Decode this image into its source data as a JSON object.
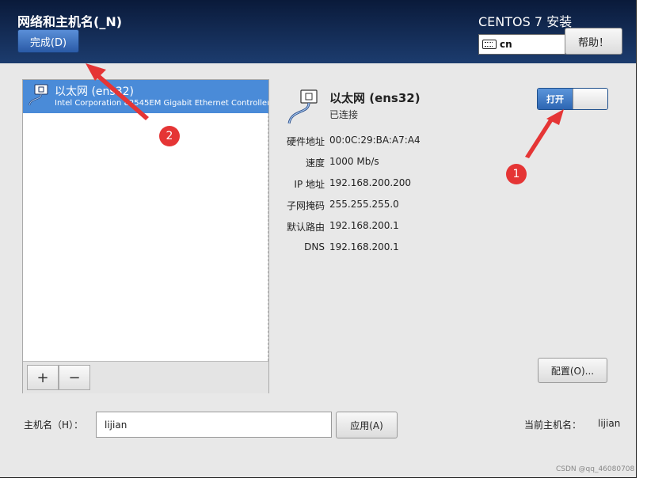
{
  "header": {
    "title": "网络和主机名(_N)",
    "done_label": "完成(D)",
    "product": "CENTOS 7 安装",
    "keyboard_layout": "cn",
    "help_label": "帮助！"
  },
  "devices": [
    {
      "name": "以太网 (ens32)",
      "description": "Intel Corporation 82545EM Gigabit Ethernet Controller (",
      "selected": true
    }
  ],
  "list_toolbar": {
    "add_label": "+",
    "remove_label": "−"
  },
  "detail": {
    "title": "以太网 (ens32)",
    "status": "已连接",
    "toggle_label": "打开",
    "toggle_on": true,
    "properties": [
      {
        "label": "硬件地址",
        "value": "00:0C:29:BA:A7:A4"
      },
      {
        "label": "速度",
        "value": "1000 Mb/s"
      },
      {
        "label": "IP 地址",
        "value": "192.168.200.200"
      },
      {
        "label": "子网掩码",
        "value": "255.255.255.0"
      },
      {
        "label": "默认路由",
        "value": "192.168.200.1"
      },
      {
        "label": "DNS",
        "value": "192.168.200.1"
      }
    ],
    "config_label": "配置(O)..."
  },
  "hostname": {
    "label": "主机名（H）：",
    "value": "lijian",
    "apply_label": "应用(A)",
    "current_label": "当前主机名：",
    "current_value": "lijian"
  },
  "annotations": {
    "badge_1": "1",
    "badge_2": "2",
    "color": "#e53535"
  },
  "watermark": "CSDN @qq_46080708",
  "colors": {
    "header_top": "#0a1a3a",
    "header_bottom": "#1c3c6e",
    "selection": "#4a8bd8",
    "toggle_on": "#2d66b3"
  }
}
